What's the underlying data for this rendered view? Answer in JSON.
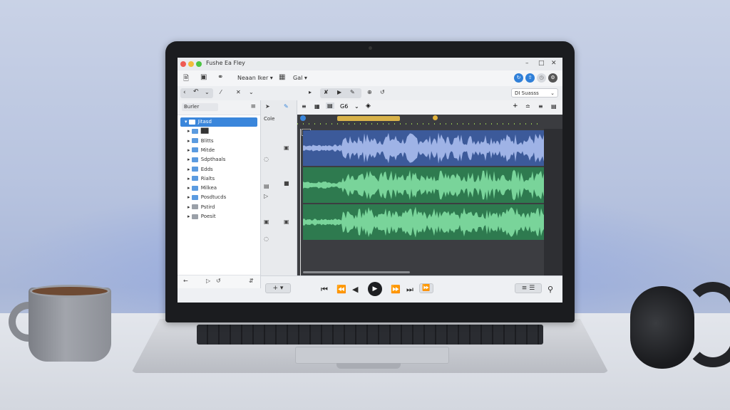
{
  "window": {
    "title": "Fushe Ea Fley"
  },
  "toolbar": {
    "menu1": "Neaan Iker",
    "menu2": "Gal",
    "icons": [
      "document-icon",
      "save-icon",
      "link-icon",
      "grid-icon"
    ]
  },
  "secondbar": {
    "select_value": "DI Suasss"
  },
  "sidebar": {
    "search_label": "Burler",
    "items": [
      {
        "label": "Jitasd",
        "icon": "folder-icon",
        "selected": true
      },
      {
        "label": "██",
        "icon": "folder-icon"
      },
      {
        "label": "Blitts",
        "icon": "folder-icon"
      },
      {
        "label": "Mitde",
        "icon": "folder-icon"
      },
      {
        "label": "Sdpthaals",
        "icon": "folder-icon"
      },
      {
        "label": "Edds",
        "icon": "folder-icon"
      },
      {
        "label": "Rialts",
        "icon": "folder-icon"
      },
      {
        "label": "Milkea",
        "icon": "folder-icon"
      },
      {
        "label": "Posdtucds",
        "icon": "folder-icon"
      },
      {
        "label": "Pstird",
        "icon": "clock-icon"
      },
      {
        "label": "Poesit",
        "icon": "square-icon"
      }
    ]
  },
  "tracks": {
    "header_label": "Cole",
    "timeline_marker": "C/",
    "zoom_label": "G6"
  },
  "colors": {
    "accent": "#3a86db",
    "vocal_lane": "#3c5a9a",
    "vocal_wave": "#9fb3e6",
    "instr_lane": "#2e7a4f",
    "instr_wave": "#79d49a",
    "region": "#d8b24a"
  }
}
